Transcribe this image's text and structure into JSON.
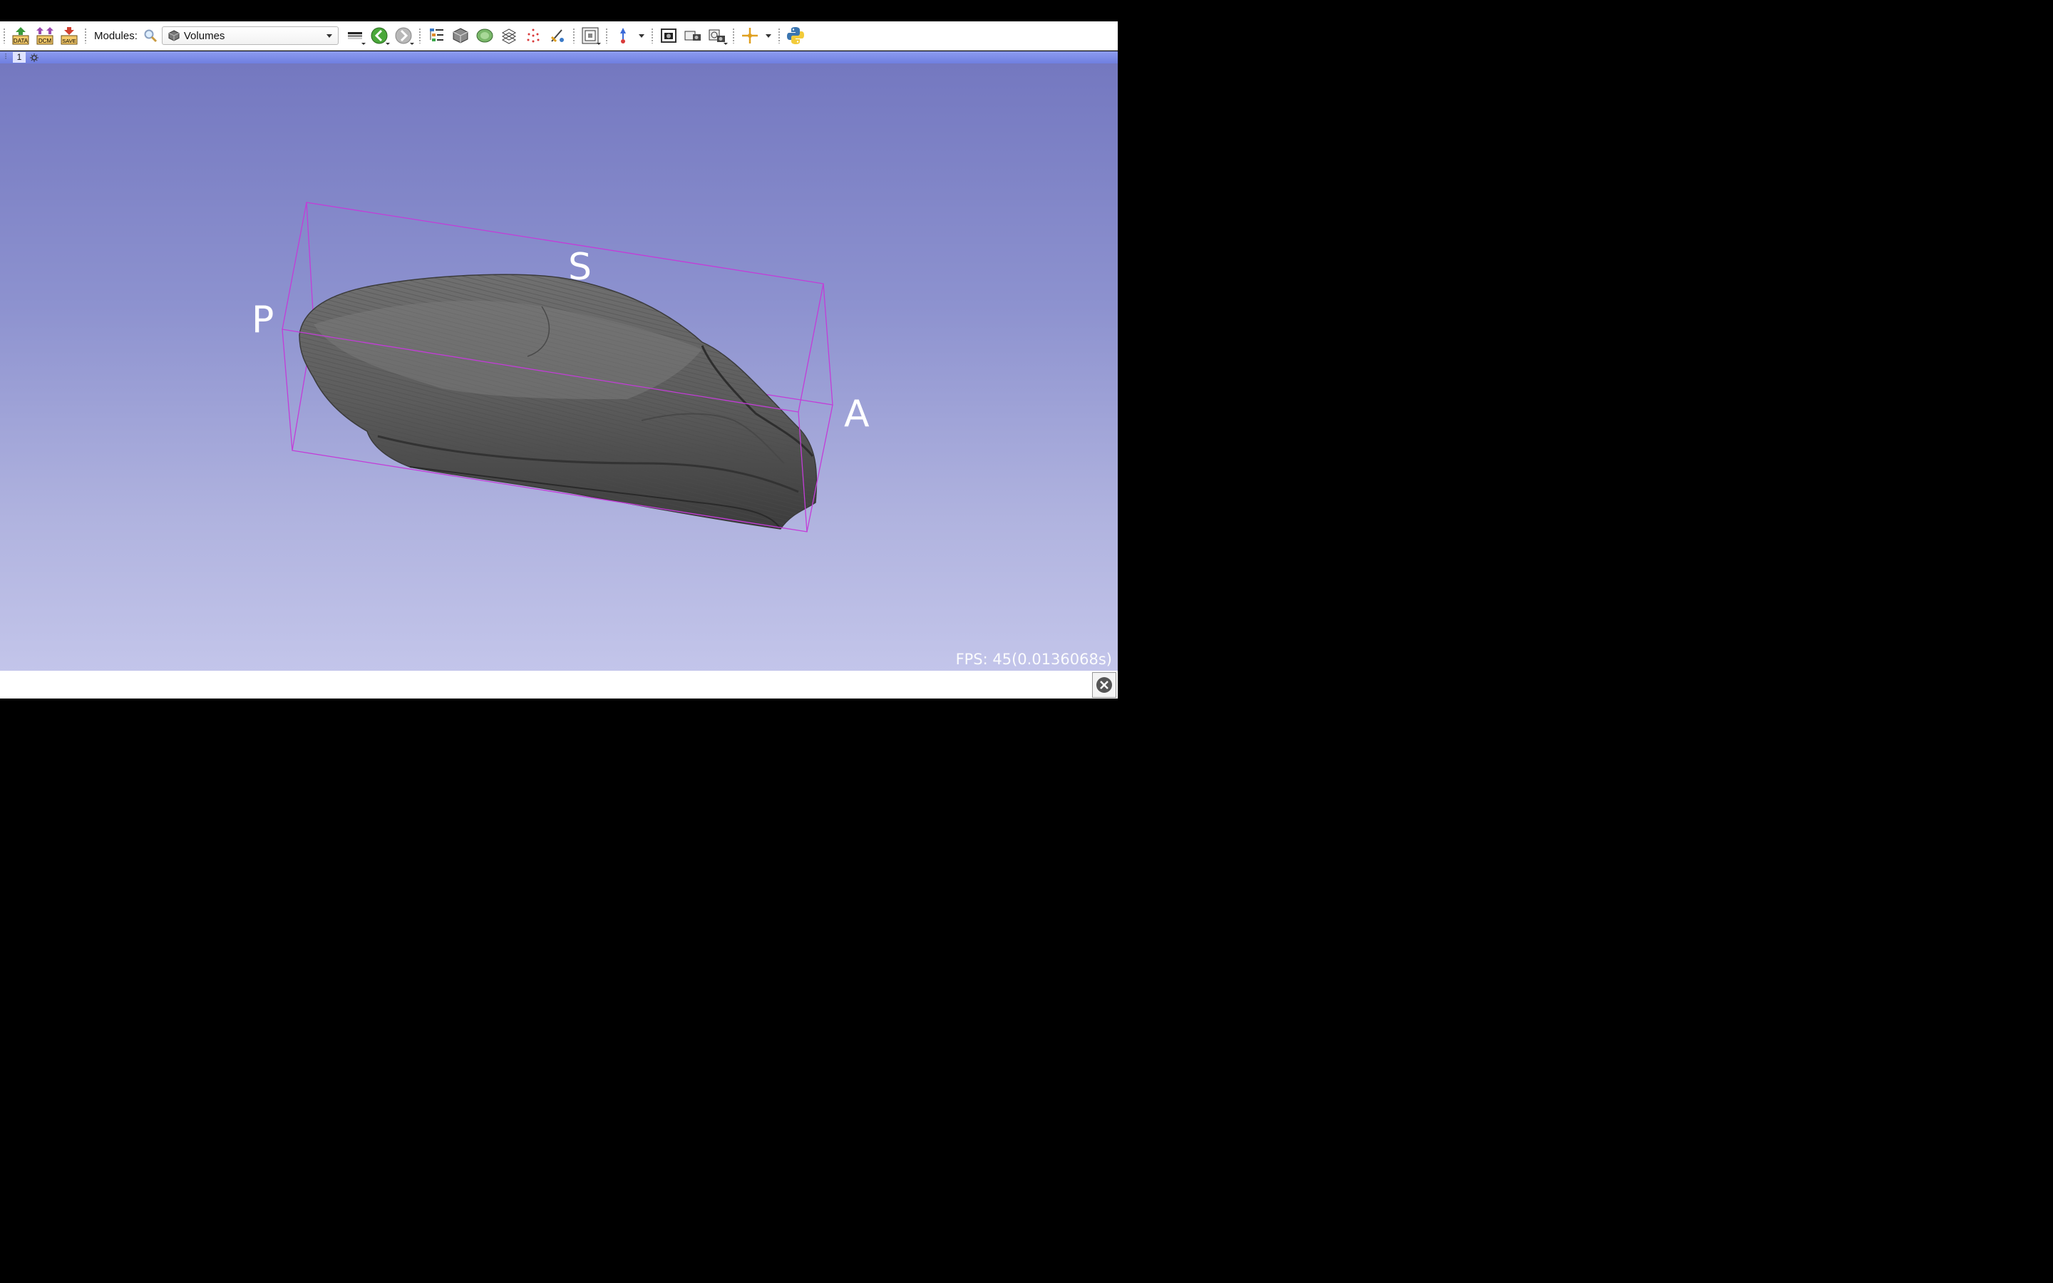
{
  "toolbar": {
    "modules_label": "Modules:",
    "module_selected": "Volumes",
    "icons": [
      "data-icon",
      "dcm-icon",
      "save-icon",
      "search-icon",
      "layout-icon",
      "back-icon",
      "forward-icon",
      "extensions-icon",
      "volume-icon",
      "segment-icon",
      "grid-icon",
      "markups-icon",
      "transform-icon",
      "viewlayout-icon",
      "crosshair-icon",
      "screenshot-icon",
      "camera-icon",
      "scene-icon",
      "mouse-mode-icon",
      "python-icon"
    ],
    "data_text": "DATA",
    "dcm_text": "DCM",
    "save_text": "SAVE"
  },
  "viewbar": {
    "view_number": "1"
  },
  "view3d": {
    "labels": {
      "superior": "S",
      "posterior": "P",
      "anterior": "A"
    },
    "fps": "FPS: 45(0.0136068s)"
  },
  "colors": {
    "box": "#c33cd8",
    "background_top": "#7478c0",
    "background_bottom": "#c3c5ea",
    "specimen": "#5a5a5a"
  }
}
